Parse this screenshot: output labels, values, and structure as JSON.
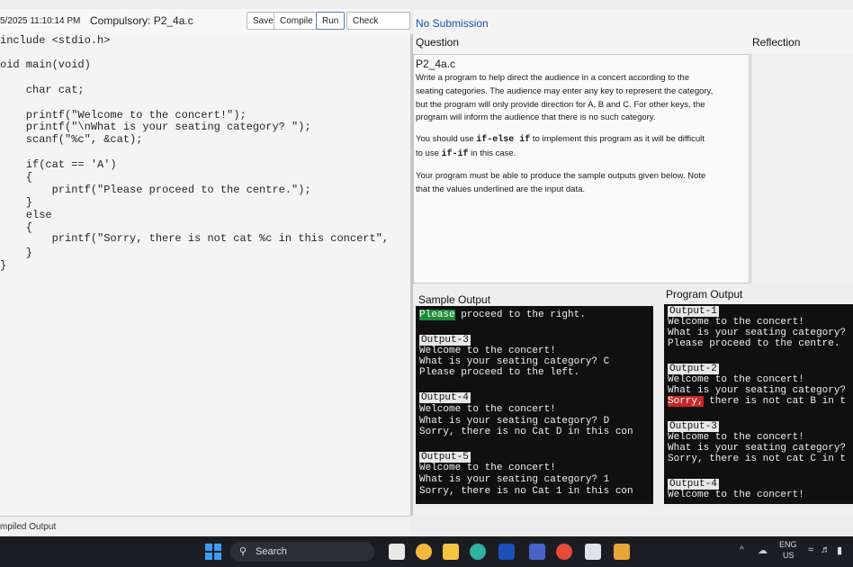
{
  "toolbar": {
    "timestamp": "5/2025 11:10:14 PM",
    "title": "Compulsory: P2_4a.c",
    "buttons": [
      "Save",
      "Compile",
      "Run",
      "Check Output"
    ]
  },
  "editor": {
    "lines": [
      "include <stdio.h>",
      "oid main(void)",
      "    char cat;",
      "    printf(\"Welcome to the concert!\");",
      "    printf(\"\\nWhat is your seating category? \");",
      "    scanf(\"%c\", &cat);",
      "    if(cat == 'A')",
      "    {",
      "        printf(\"Please proceed to the centre.\");",
      "    }",
      "    else",
      "    {",
      "        printf(\"Sorry, there is not cat %c in this concert\",",
      "    }",
      "}"
    ]
  },
  "compiled_output_label": "mpiled Output",
  "submission_status": "No Submission",
  "question_label": "Question",
  "reflection_label": "Reflection",
  "question": {
    "title": "P2_4a.c",
    "para1": [
      "Write a program to help direct the audience in a concert according to the",
      "seating categories. The audience may enter any key to represent the category,",
      "but the program will only provide direction for A, B and C. For other keys, the",
      "program will inform the audience that there is no such category."
    ],
    "para2_pre": "You should use ",
    "para2_code1": "if-else if",
    "para2_mid": " to implement this program as it will be difficult",
    "para2_pre2": "to use ",
    "para2_code2": "if-if",
    "para2_post": " in this case.",
    "para3": [
      "Your program must be able to produce the sample outputs given below. Note",
      "that the values underlined are the input data."
    ]
  },
  "sample_output": {
    "label": "Sample Output",
    "lines": [
      {
        "label": "",
        "highlight": "Please",
        "text": " proceed to the right."
      },
      {
        "label": "Output-3"
      },
      {
        "text": "Welcome to the concert!"
      },
      {
        "text": "What is your seating category? C"
      },
      {
        "text": "Please proceed to the left."
      },
      {
        "label": "Output-4"
      },
      {
        "text": "Welcome to the concert!"
      },
      {
        "text": "What is your seating category? D"
      },
      {
        "text": "Sorry, there is no Cat D in this con"
      },
      {
        "label": "Output-5"
      },
      {
        "text": "Welcome to the concert!"
      },
      {
        "text": "What is your seating category? 1"
      },
      {
        "text": "Sorry, there is no Cat 1 in this con"
      }
    ]
  },
  "program_output": {
    "label": "Program Output",
    "blocks": [
      {
        "label": "Output-1",
        "lines": [
          "Welcome to the concert!",
          "What is your seating category?",
          "Please proceed to the centre."
        ]
      },
      {
        "label": "Output-2",
        "lines": [
          "Welcome to the concert!",
          "What is your seating category?"
        ],
        "red": "Sorry,",
        "red_rest": " there is not cat B in t"
      },
      {
        "label": "Output-3",
        "lines": [
          "Welcome to the concert!",
          "What is your seating category?",
          "Sorry, there is not cat C in t"
        ]
      },
      {
        "label": "Output-4",
        "lines": [
          "Welcome to the concert!"
        ]
      }
    ]
  },
  "taskbar": {
    "search_placeholder": "Search",
    "lang": "ENG",
    "region": "US"
  },
  "colors": {
    "terminal_bg": "#101010",
    "highlight_green": "#1f8a3a",
    "highlight_red": "#c62828",
    "taskbar_bg": "#1b1d23"
  }
}
